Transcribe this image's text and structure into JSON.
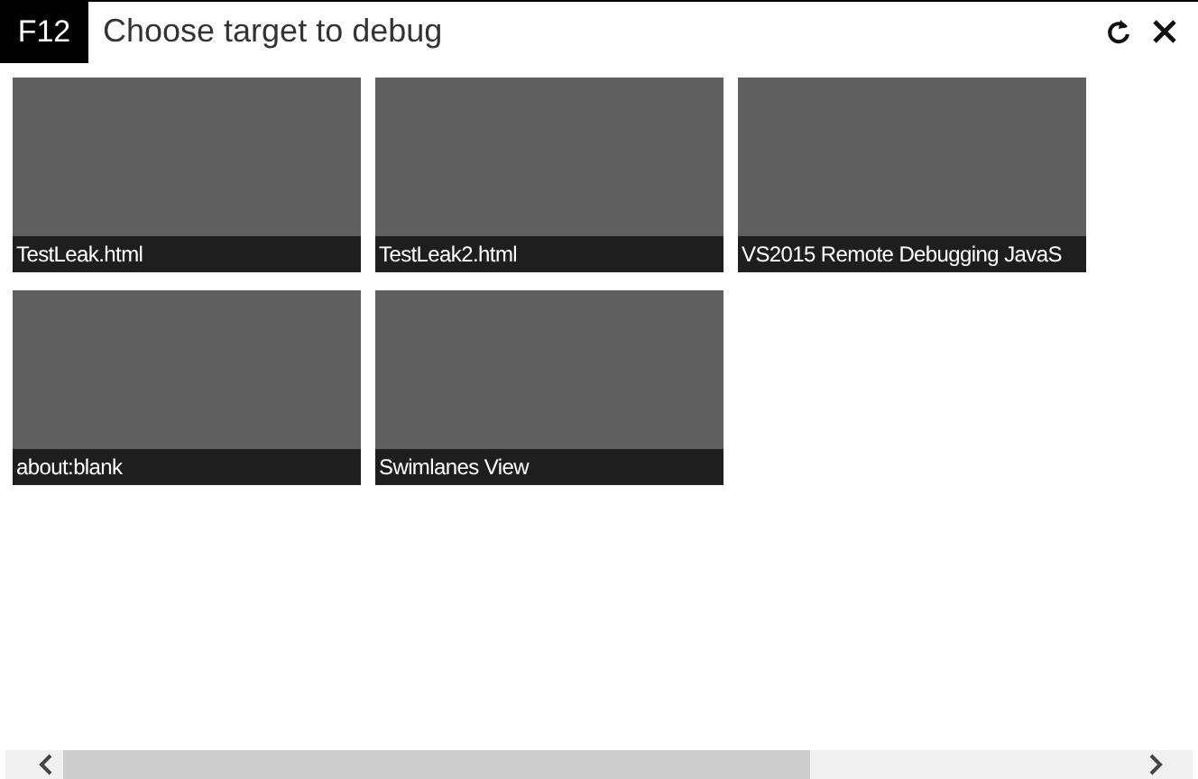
{
  "header": {
    "badge": "F12",
    "title": "Choose target to debug"
  },
  "targets": [
    {
      "label": "TestLeak.html"
    },
    {
      "label": "TestLeak2.html"
    },
    {
      "label": "VS2015 Remote Debugging JavaS"
    },
    {
      "label": "about:blank"
    },
    {
      "label": "Swimlanes View"
    }
  ]
}
